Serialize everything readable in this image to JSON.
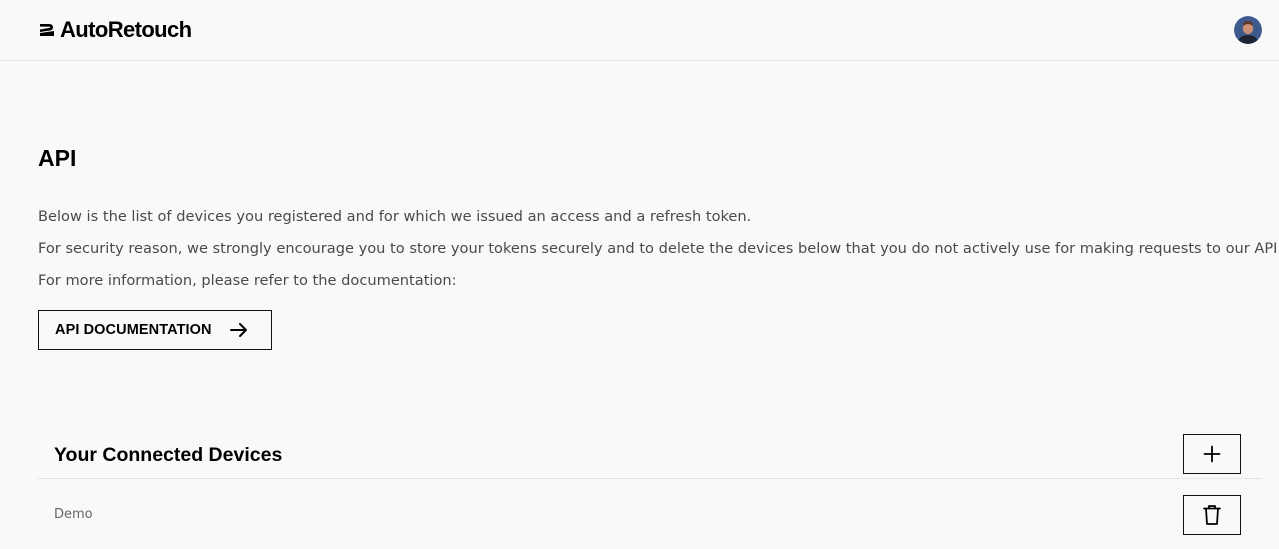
{
  "header": {
    "logo_text": "AutoRetouch",
    "avatar_icon": "user-avatar"
  },
  "main": {
    "title": "API",
    "description": [
      "Below is the list of devices you registered and for which we issued an access and a refresh token.",
      "For security reason, we strongly encourage you to store your tokens securely and to delete the devices below that you do not actively use for making requests to our API.",
      "For more information, please refer to the documentation:"
    ],
    "doc_button": {
      "label": "API DOCUMENTATION",
      "icon": "arrow-right-icon"
    }
  },
  "devices": {
    "title": "Your Connected Devices",
    "add_icon": "plus-icon",
    "items": [
      {
        "name": "Demo",
        "delete_icon": "trash-icon"
      }
    ]
  },
  "colors": {
    "background": "#f9f9f9",
    "text_primary": "#000000",
    "text_secondary": "#4a4a4a",
    "border": "#111111",
    "divider": "#e4e4e4"
  }
}
